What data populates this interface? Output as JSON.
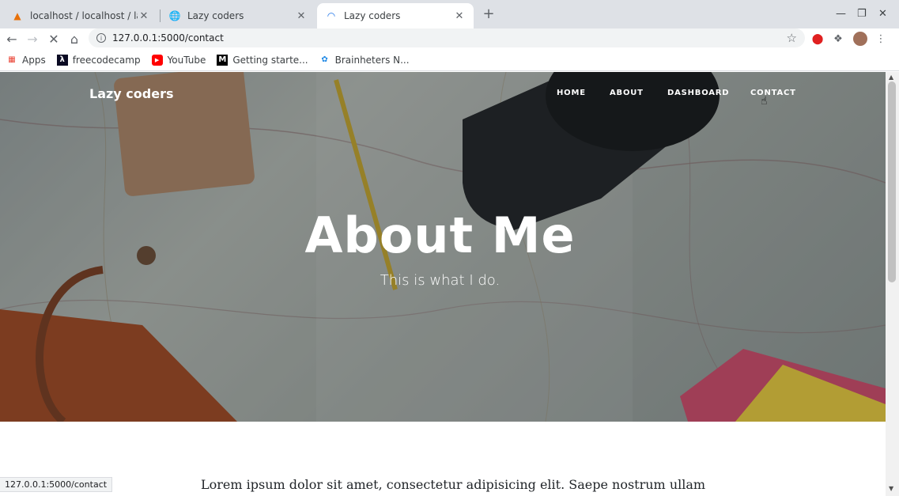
{
  "browser": {
    "tabs": [
      {
        "title": "localhost / localhost / lazy",
        "active": false
      },
      {
        "title": "Lazy coders",
        "active": false
      },
      {
        "title": "Lazy coders",
        "active": true
      }
    ],
    "new_tab_symbol": "+",
    "url": "127.0.0.1:5000/contact",
    "bookmarks": [
      {
        "label": "Apps",
        "icon": "apps-grid-icon"
      },
      {
        "label": "freecodecamp",
        "icon": "freecodecamp-icon"
      },
      {
        "label": "YouTube",
        "icon": "youtube-icon"
      },
      {
        "label": "Getting starte...",
        "icon": "medium-icon"
      },
      {
        "label": "Brainheters N...",
        "icon": "brainheters-icon"
      }
    ],
    "status_url": "127.0.0.1:5000/contact"
  },
  "site": {
    "brand": "Lazy coders",
    "nav": [
      "HOME",
      "ABOUT",
      "DASHBOARD",
      "CONTACT"
    ],
    "hero_title": "About Me",
    "hero_subtitle": "This is what I do.",
    "body_text": "Lorem ipsum dolor sit amet, consectetur adipisicing elit. Saepe nostrum ullam"
  },
  "colors": {
    "tabstrip": "#dee1e6",
    "accent_stop": "#d93025"
  }
}
